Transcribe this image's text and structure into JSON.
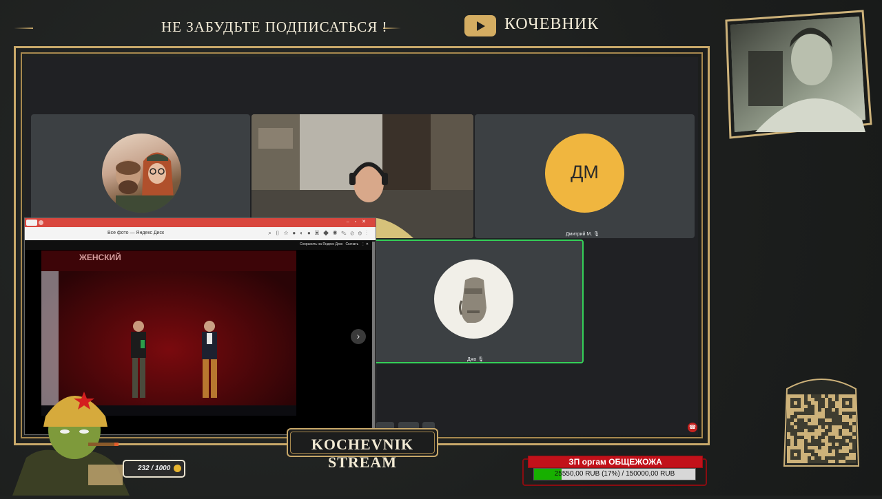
{
  "banner": {
    "reminder_text": "НЕ ЗАБУДЬТЕ ПОДПИСАТЬСЯ !",
    "channel_name": "КОЧЕВНИК"
  },
  "call": {
    "participants": [
      {
        "id": "cartoon-avatar",
        "name": ""
      },
      {
        "id": "headphones-guy",
        "name": ""
      },
      {
        "id": "dm",
        "initials": "ДМ",
        "name": "Дмитрий М.",
        "avatar_color": "#f0b63f"
      },
      {
        "id": "moai",
        "name": "Джо",
        "speaking_border": "#34d058"
      }
    ]
  },
  "browser": {
    "tab_title": "Все фото — Яндекс Диск",
    "save_label": "Сохранить на Яндекс Диск",
    "download_label": "Скачать",
    "next_icon": "chevron-right-icon",
    "photo_banner": "ЖЕНСКИЙ"
  },
  "overlay": {
    "stream_title": "KOCHEVNIK STREAM",
    "counter": "232 / 1000",
    "goal_title": "ЗП оргам ОБЩЕЖОЖА",
    "goal_progress": "25550,00 RUB (17%) / 150000,00 RUB",
    "goal_fraction": 0.17,
    "accent_gold": "#c9a96a",
    "goal_red": "#c2111a",
    "goal_green": "#17b000"
  }
}
